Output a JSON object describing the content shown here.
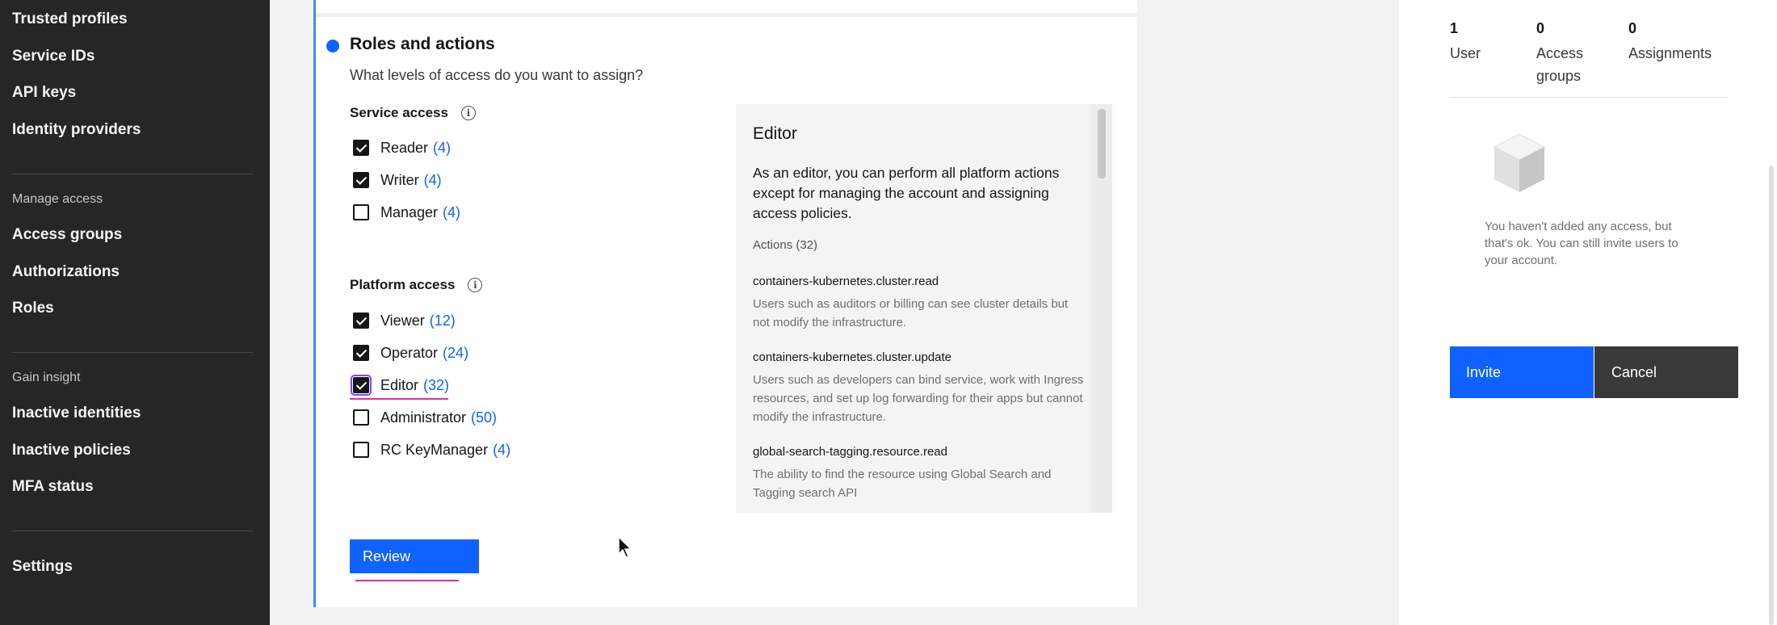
{
  "sidebar": {
    "items_top": [
      "Trusted profiles",
      "Service IDs",
      "API keys",
      "Identity providers"
    ],
    "manage_heading": "Manage access",
    "manage_items": [
      "Access groups",
      "Authorizations",
      "Roles"
    ],
    "insight_heading": "Gain insight",
    "insight_items": [
      "Inactive identities",
      "Inactive policies",
      "MFA status"
    ],
    "settings": "Settings"
  },
  "step": {
    "title": "Roles and actions",
    "description": "What levels of access do you want to assign?"
  },
  "service_access": {
    "title": "Service access",
    "options": [
      {
        "label": "Reader",
        "count": "(4)",
        "checked": true
      },
      {
        "label": "Writer",
        "count": "(4)",
        "checked": true
      },
      {
        "label": "Manager",
        "count": "(4)",
        "checked": false
      }
    ]
  },
  "platform_access": {
    "title": "Platform access",
    "options": [
      {
        "label": "Viewer",
        "count": "(12)",
        "checked": true
      },
      {
        "label": "Operator",
        "count": "(24)",
        "checked": true
      },
      {
        "label": "Editor",
        "count": "(32)",
        "checked": true
      },
      {
        "label": "Administrator",
        "count": "(50)",
        "checked": false
      },
      {
        "label": "RC KeyManager",
        "count": "(4)",
        "checked": false
      }
    ]
  },
  "review_button": "Review",
  "detail": {
    "title": "Editor",
    "description": "As an editor, you can perform all platform actions except for managing the account and assigning access policies.",
    "actions_heading": "Actions (32)",
    "actions": [
      {
        "name": "containers-kubernetes.cluster.read",
        "description": "Users such as auditors or billing can see cluster details but not modify the infrastructure."
      },
      {
        "name": "containers-kubernetes.cluster.update",
        "description": "Users such as developers can bind service, work with Ingress resources, and set up log forwarding for their apps but cannot modify the infrastructure."
      },
      {
        "name": "global-search-tagging.resource.read",
        "description": "The ability to find the resource using Global Search and Tagging search API"
      }
    ]
  },
  "summary": {
    "stats": [
      {
        "num": "1",
        "label": "User"
      },
      {
        "num": "0",
        "label": "Access groups"
      },
      {
        "num": "0",
        "label": "Assignments"
      }
    ],
    "empty_message": "You haven't added any access, but that's ok. You can still invite users to your account.",
    "invite": "Invite",
    "cancel": "Cancel"
  },
  "colors": {
    "primary": "#0f62fe",
    "sidebar_bg": "#262626",
    "highlight": "#e62e9e"
  }
}
